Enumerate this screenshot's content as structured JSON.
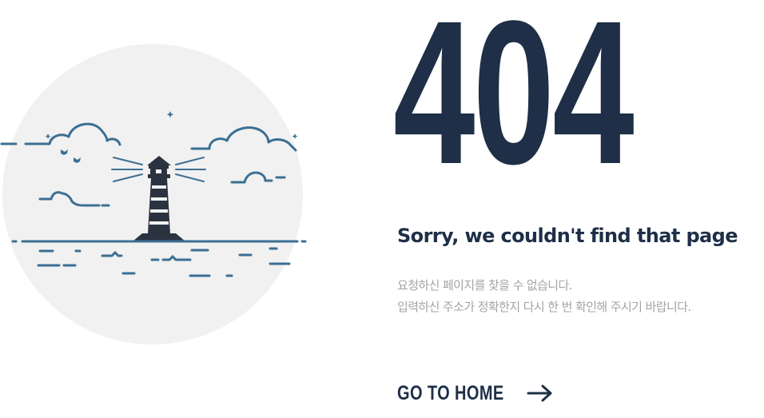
{
  "error": {
    "code": "404",
    "title": "Sorry, we couldn't find that page",
    "message_lines": [
      "요청하신 페이지를 찾을 수 없습니다.",
      "입력하신 주소가 정확한지 다시 한 번 확인해 주시기 바랍니다."
    ]
  },
  "home_link": {
    "label": "GO TO HOME",
    "icon": "arrow-right-icon"
  },
  "illustration": {
    "icon": "lighthouse-icon"
  },
  "colors": {
    "navy": "#1e2f47",
    "sea_blue": "#3b6f93",
    "circle_bg": "#f1f1f1",
    "muted_text": "#a4a4a4"
  }
}
